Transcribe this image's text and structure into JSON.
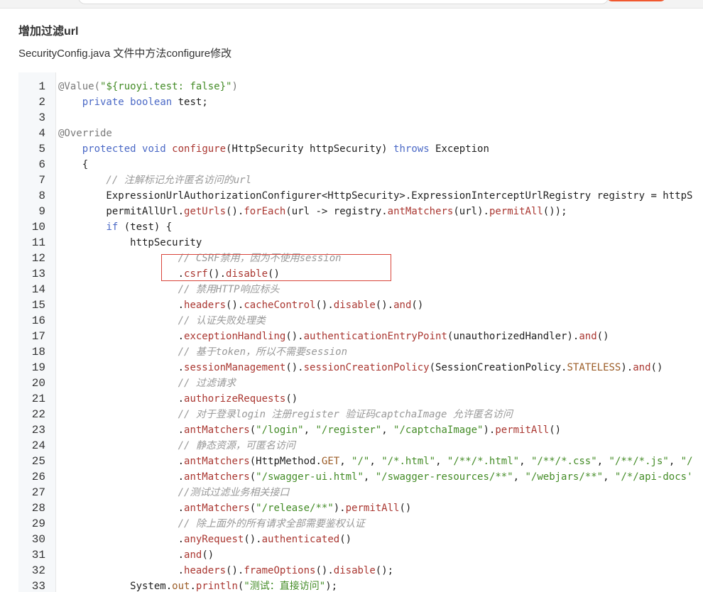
{
  "header": {
    "heading": "增加过滤url",
    "description": "SecurityConfig.java 文件中方法configure修改"
  },
  "colors": {
    "comment": "#999999",
    "keyword": "#4b69c6",
    "string": "#448c27",
    "method": "#aa3731",
    "annotation": "#7a7a7a",
    "default": "#1f1f1f",
    "constant": "#9c5d27",
    "highlight_border": "#d9453a"
  },
  "code": {
    "lines": [
      {
        "n": "1",
        "tokens": [
          [
            "annotation",
            "@Value("
          ],
          [
            "string",
            "\"${ruoyi.test: false}\""
          ],
          [
            "annotation",
            ")"
          ]
        ]
      },
      {
        "n": "2",
        "tokens": [
          [
            "default",
            "    "
          ],
          [
            "keyword",
            "private"
          ],
          [
            "default",
            " "
          ],
          [
            "keyword",
            "boolean"
          ],
          [
            "default",
            " test;"
          ]
        ]
      },
      {
        "n": "3",
        "tokens": []
      },
      {
        "n": "4",
        "tokens": [
          [
            "annotation",
            "@Override"
          ]
        ]
      },
      {
        "n": "5",
        "tokens": [
          [
            "default",
            "    "
          ],
          [
            "keyword",
            "protected"
          ],
          [
            "default",
            " "
          ],
          [
            "keyword",
            "void"
          ],
          [
            "default",
            " "
          ],
          [
            "method",
            "configure"
          ],
          [
            "default",
            "(HttpSecurity httpSecurity) "
          ],
          [
            "keyword",
            "throws"
          ],
          [
            "default",
            " Exception"
          ]
        ]
      },
      {
        "n": "6",
        "tokens": [
          [
            "default",
            "    {"
          ]
        ]
      },
      {
        "n": "7",
        "tokens": [
          [
            "comment",
            "        // 注解标记允许匿名访问的url"
          ]
        ]
      },
      {
        "n": "8",
        "tokens": [
          [
            "default",
            "        ExpressionUrlAuthorizationConfigurer<HttpSecurity>.ExpressionInterceptUrlRegistry registry = httpS"
          ]
        ]
      },
      {
        "n": "9",
        "tokens": [
          [
            "default",
            "        permitAllUrl."
          ],
          [
            "method",
            "getUrls"
          ],
          [
            "default",
            "()."
          ],
          [
            "method",
            "forEach"
          ],
          [
            "default",
            "(url -> registry."
          ],
          [
            "method",
            "antMatchers"
          ],
          [
            "default",
            "(url)."
          ],
          [
            "method",
            "permitAll"
          ],
          [
            "default",
            "());"
          ]
        ]
      },
      {
        "n": "10",
        "tokens": [
          [
            "default",
            "        "
          ],
          [
            "keyword",
            "if"
          ],
          [
            "default",
            " (test) {"
          ]
        ]
      },
      {
        "n": "11",
        "tokens": [
          [
            "default",
            "            httpSecurity"
          ]
        ]
      },
      {
        "n": "12",
        "tokens": [
          [
            "comment",
            "                    // CSRF禁用，因为不使用session"
          ]
        ]
      },
      {
        "n": "13",
        "tokens": [
          [
            "default",
            "                    ."
          ],
          [
            "method",
            "csrf"
          ],
          [
            "default",
            "()."
          ],
          [
            "method",
            "disable"
          ],
          [
            "default",
            "()"
          ]
        ]
      },
      {
        "n": "14",
        "tokens": [
          [
            "comment",
            "                    // 禁用HTTP响应标头"
          ]
        ]
      },
      {
        "n": "15",
        "tokens": [
          [
            "default",
            "                    ."
          ],
          [
            "method",
            "headers"
          ],
          [
            "default",
            "()."
          ],
          [
            "method",
            "cacheControl"
          ],
          [
            "default",
            "()."
          ],
          [
            "method",
            "disable"
          ],
          [
            "default",
            "()."
          ],
          [
            "method",
            "and"
          ],
          [
            "default",
            "()"
          ]
        ]
      },
      {
        "n": "16",
        "tokens": [
          [
            "comment",
            "                    // 认证失败处理类"
          ]
        ]
      },
      {
        "n": "17",
        "tokens": [
          [
            "default",
            "                    ."
          ],
          [
            "method",
            "exceptionHandling"
          ],
          [
            "default",
            "()."
          ],
          [
            "method",
            "authenticationEntryPoint"
          ],
          [
            "default",
            "(unauthorizedHandler)."
          ],
          [
            "method",
            "and"
          ],
          [
            "default",
            "()"
          ]
        ]
      },
      {
        "n": "18",
        "tokens": [
          [
            "comment",
            "                    // 基于token，所以不需要session"
          ]
        ]
      },
      {
        "n": "19",
        "tokens": [
          [
            "default",
            "                    ."
          ],
          [
            "method",
            "sessionManagement"
          ],
          [
            "default",
            "()."
          ],
          [
            "method",
            "sessionCreationPolicy"
          ],
          [
            "default",
            "(SessionCreationPolicy."
          ],
          [
            "constant",
            "STATELESS"
          ],
          [
            "default",
            ")."
          ],
          [
            "method",
            "and"
          ],
          [
            "default",
            "()"
          ]
        ]
      },
      {
        "n": "20",
        "tokens": [
          [
            "comment",
            "                    // 过滤请求"
          ]
        ]
      },
      {
        "n": "21",
        "tokens": [
          [
            "default",
            "                    ."
          ],
          [
            "method",
            "authorizeRequests"
          ],
          [
            "default",
            "()"
          ]
        ]
      },
      {
        "n": "22",
        "tokens": [
          [
            "comment",
            "                    // 对于登录login 注册register 验证码captchaImage 允许匿名访问"
          ]
        ]
      },
      {
        "n": "23",
        "tokens": [
          [
            "default",
            "                    ."
          ],
          [
            "method",
            "antMatchers"
          ],
          [
            "default",
            "("
          ],
          [
            "string",
            "\"/login\""
          ],
          [
            "default",
            ", "
          ],
          [
            "string",
            "\"/register\""
          ],
          [
            "default",
            ", "
          ],
          [
            "string",
            "\"/captchaImage\""
          ],
          [
            "default",
            ")."
          ],
          [
            "method",
            "permitAll"
          ],
          [
            "default",
            "()"
          ]
        ]
      },
      {
        "n": "24",
        "tokens": [
          [
            "comment",
            "                    // 静态资源，可匿名访问"
          ]
        ]
      },
      {
        "n": "25",
        "tokens": [
          [
            "default",
            "                    ."
          ],
          [
            "method",
            "antMatchers"
          ],
          [
            "default",
            "(HttpMethod."
          ],
          [
            "constant",
            "GET"
          ],
          [
            "default",
            ", "
          ],
          [
            "string",
            "\"/\""
          ],
          [
            "default",
            ", "
          ],
          [
            "string",
            "\"/*.html\""
          ],
          [
            "default",
            ", "
          ],
          [
            "string",
            "\"/**/*.html\""
          ],
          [
            "default",
            ", "
          ],
          [
            "string",
            "\"/**/*.css\""
          ],
          [
            "default",
            ", "
          ],
          [
            "string",
            "\"/**/*.js\""
          ],
          [
            "default",
            ", "
          ],
          [
            "string",
            "\"/"
          ]
        ]
      },
      {
        "n": "26",
        "tokens": [
          [
            "default",
            "                    ."
          ],
          [
            "method",
            "antMatchers"
          ],
          [
            "default",
            "("
          ],
          [
            "string",
            "\"/swagger-ui.html\""
          ],
          [
            "default",
            ", "
          ],
          [
            "string",
            "\"/swagger-resources/**\""
          ],
          [
            "default",
            ", "
          ],
          [
            "string",
            "\"/webjars/**\""
          ],
          [
            "default",
            ", "
          ],
          [
            "string",
            "\"/*/api-docs'"
          ]
        ]
      },
      {
        "n": "27",
        "tokens": [
          [
            "comment",
            "                    //测试过滤业务相关接口"
          ]
        ]
      },
      {
        "n": "28",
        "tokens": [
          [
            "default",
            "                    ."
          ],
          [
            "method",
            "antMatchers"
          ],
          [
            "default",
            "("
          ],
          [
            "string",
            "\"/release/**\""
          ],
          [
            "default",
            ")."
          ],
          [
            "method",
            "permitAll"
          ],
          [
            "default",
            "()"
          ]
        ]
      },
      {
        "n": "29",
        "tokens": [
          [
            "comment",
            "                    // 除上面外的所有请求全部需要鉴权认证"
          ]
        ]
      },
      {
        "n": "30",
        "tokens": [
          [
            "default",
            "                    ."
          ],
          [
            "method",
            "anyRequest"
          ],
          [
            "default",
            "()."
          ],
          [
            "method",
            "authenticated"
          ],
          [
            "default",
            "()"
          ]
        ]
      },
      {
        "n": "31",
        "tokens": [
          [
            "default",
            "                    ."
          ],
          [
            "method",
            "and"
          ],
          [
            "default",
            "()"
          ]
        ]
      },
      {
        "n": "32",
        "tokens": [
          [
            "default",
            "                    ."
          ],
          [
            "method",
            "headers"
          ],
          [
            "default",
            "()."
          ],
          [
            "method",
            "frameOptions"
          ],
          [
            "default",
            "()."
          ],
          [
            "method",
            "disable"
          ],
          [
            "default",
            "();"
          ]
        ]
      },
      {
        "n": "33",
        "tokens": [
          [
            "default",
            "            System."
          ],
          [
            "constant",
            "out"
          ],
          [
            "default",
            "."
          ],
          [
            "method",
            "println"
          ],
          [
            "default",
            "("
          ],
          [
            "string",
            "\"测试：直接访问\""
          ],
          [
            "default",
            ");"
          ]
        ]
      }
    ]
  }
}
